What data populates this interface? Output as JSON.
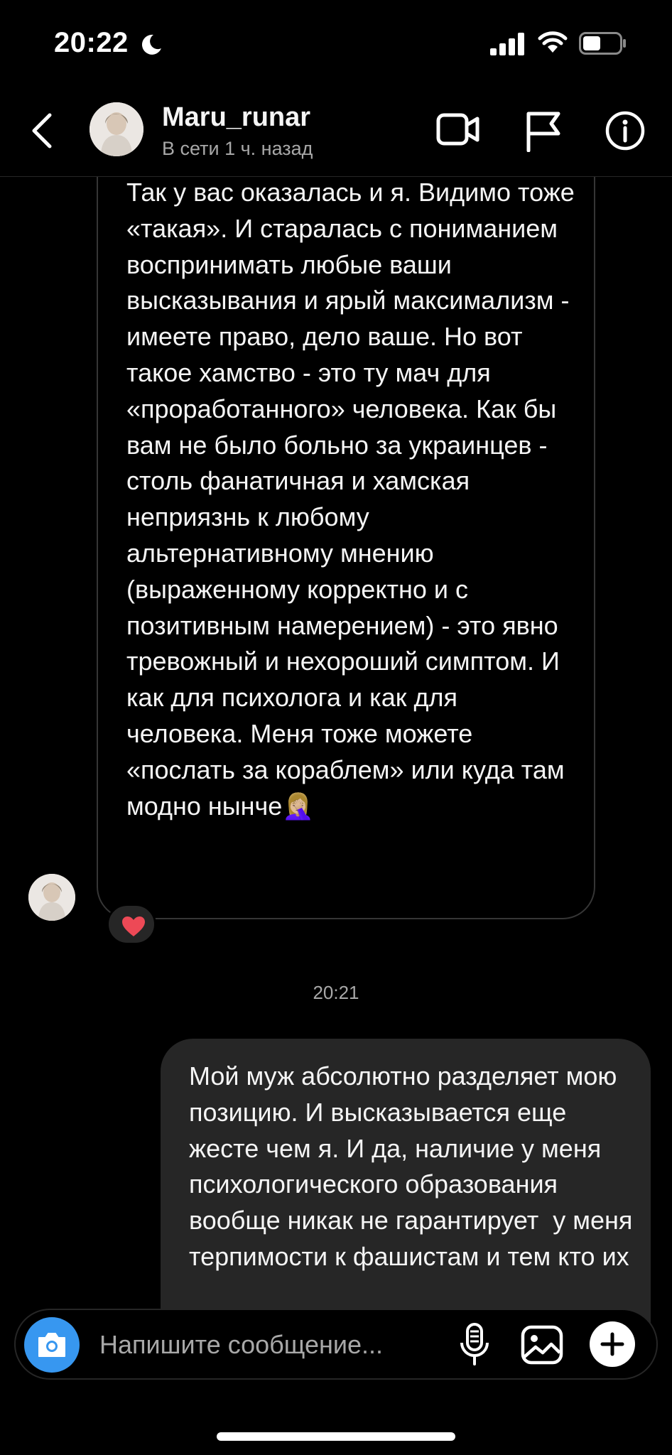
{
  "status_bar": {
    "time": "20:22"
  },
  "header": {
    "username": "Maru_runar",
    "status": "В сети 1 ч. назад"
  },
  "messages": {
    "incoming_text": "Так у вас оказалась и я. Видимо тоже «такая». И старалась с пониманием воспринимать любые ваши высказывания и ярый максимализм - имеете право, дело ваше. Но вот такое хамство - это ту мач для «проработанного» человека. Как бы вам не было больно за украинцев - столь фанатичная и хамская неприязнь к любому альтернативному мнению (выраженному корректно и с позитивным намерением) - это явно тревожный и нехороший симптом. И как для психолога и как для человека. Меня тоже можете «послать за кораблем» или куда там модно нынче",
    "incoming_emoji": "🤦🏼‍♀️",
    "reaction": "❤️",
    "timestamp": "20:21",
    "outgoing_text": "Мой муж абсолютно разделяет мою позицию. И высказывается еще жесте чем я. И да, наличие у меня психологического образования   вообще никак не гарантирует  у меня терпимости к фашистам и тем кто их"
  },
  "composer": {
    "placeholder": "Напишите сообщение..."
  },
  "icons": {
    "accent_color": "#3797f0",
    "reaction_color": "#ed4956"
  }
}
